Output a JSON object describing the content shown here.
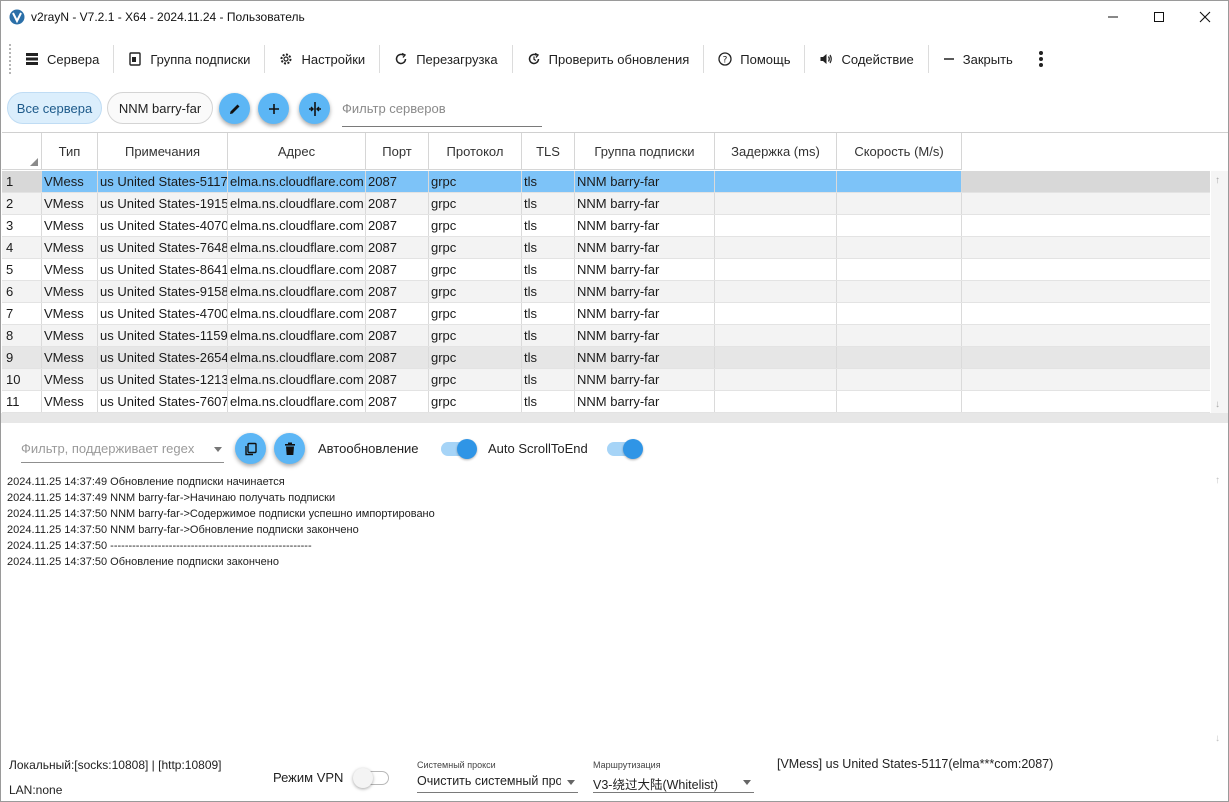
{
  "window": {
    "title": "v2rayN - V7.2.1 - X64 - 2024.11.24 - Пользователь"
  },
  "toolbar": {
    "servers": "Сервера",
    "subscription_group": "Группа подписки",
    "settings": "Настройки",
    "restart": "Перезагрузка",
    "check_updates": "Проверить обновления",
    "help": "Помощь",
    "promotion": "Содействие",
    "close": "Закрыть"
  },
  "filters": {
    "all_servers": "Все сервера",
    "subscription_chip": "NNM barry-far",
    "server_filter_placeholder": "Фильтр серверов"
  },
  "grid": {
    "columns": [
      "Тип",
      "Примечания",
      "Адрес",
      "Порт",
      "Протокол",
      "TLS",
      "Группа подписки",
      "Задержка (ms)",
      "Скорость (M/s)"
    ],
    "rows": [
      {
        "n": "1",
        "type": "VMess",
        "remarks": "us United States-5117",
        "address": "elma.ns.cloudflare.com",
        "port": "2087",
        "protocol": "grpc",
        "tls": "tls",
        "group": "NNM barry-far",
        "delay": "",
        "speed": ""
      },
      {
        "n": "2",
        "type": "VMess",
        "remarks": "us United States-1915",
        "address": "elma.ns.cloudflare.com",
        "port": "2087",
        "protocol": "grpc",
        "tls": "tls",
        "group": "NNM barry-far",
        "delay": "",
        "speed": ""
      },
      {
        "n": "3",
        "type": "VMess",
        "remarks": "us United States-4070",
        "address": "elma.ns.cloudflare.com",
        "port": "2087",
        "protocol": "grpc",
        "tls": "tls",
        "group": "NNM barry-far",
        "delay": "",
        "speed": ""
      },
      {
        "n": "4",
        "type": "VMess",
        "remarks": "us United States-7648",
        "address": "elma.ns.cloudflare.com",
        "port": "2087",
        "protocol": "grpc",
        "tls": "tls",
        "group": "NNM barry-far",
        "delay": "",
        "speed": ""
      },
      {
        "n": "5",
        "type": "VMess",
        "remarks": "us United States-8641",
        "address": "elma.ns.cloudflare.com",
        "port": "2087",
        "protocol": "grpc",
        "tls": "tls",
        "group": "NNM barry-far",
        "delay": "",
        "speed": ""
      },
      {
        "n": "6",
        "type": "VMess",
        "remarks": "us United States-9158",
        "address": "elma.ns.cloudflare.com",
        "port": "2087",
        "protocol": "grpc",
        "tls": "tls",
        "group": "NNM barry-far",
        "delay": "",
        "speed": ""
      },
      {
        "n": "7",
        "type": "VMess",
        "remarks": "us United States-4700",
        "address": "elma.ns.cloudflare.com",
        "port": "2087",
        "protocol": "grpc",
        "tls": "tls",
        "group": "NNM barry-far",
        "delay": "",
        "speed": ""
      },
      {
        "n": "8",
        "type": "VMess",
        "remarks": "us United States-1159",
        "address": "elma.ns.cloudflare.com",
        "port": "2087",
        "protocol": "grpc",
        "tls": "tls",
        "group": "NNM barry-far",
        "delay": "",
        "speed": ""
      },
      {
        "n": "9",
        "type": "VMess",
        "remarks": "us United States-2654",
        "address": "elma.ns.cloudflare.com",
        "port": "2087",
        "protocol": "grpc",
        "tls": "tls",
        "group": "NNM barry-far",
        "delay": "",
        "speed": ""
      },
      {
        "n": "10",
        "type": "VMess",
        "remarks": "us United States-1213",
        "address": "elma.ns.cloudflare.com",
        "port": "2087",
        "protocol": "grpc",
        "tls": "tls",
        "group": "NNM barry-far",
        "delay": "",
        "speed": ""
      },
      {
        "n": "11",
        "type": "VMess",
        "remarks": "us United States-7607",
        "address": "elma.ns.cloudflare.com",
        "port": "2087",
        "protocol": "grpc",
        "tls": "tls",
        "group": "NNM barry-far",
        "delay": "",
        "speed": ""
      }
    ],
    "selected_row": 0
  },
  "log": {
    "filter_placeholder": "Фильтр, поддерживает regex",
    "auto_refresh_label": "Автообновление",
    "auto_scroll_label": "Auto ScrollToEnd",
    "lines": [
      "2024.11.25 14:37:49 Обновление подписки начинается",
      "2024.11.25 14:37:49 NNM barry-far->Начинаю получать подписки",
      "2024.11.25 14:37:50 NNM barry-far->Содержимое подписки успешно импортировано",
      "2024.11.25 14:37:50 NNM barry-far->Обновление подписки закончено",
      "2024.11.25 14:37:50 -------------------------------------------------------",
      "2024.11.25 14:37:50 Обновление подписки закончено"
    ]
  },
  "status": {
    "local": "Локальный:[socks:10808] | [http:10809]",
    "lan": "LAN:none",
    "vpn_mode": "Режим VPN",
    "system_proxy_caption": "Системный прокси",
    "system_proxy_value": "Очистить системный прокси",
    "routing_caption": "Маршрутизация",
    "routing_value": "V3-绕过大陆(Whitelist)",
    "active_server": "[VMess] us United States-5117(elma***com:2087)"
  },
  "colors": {
    "accent": "#2f95e6",
    "selection": "#7dc3f8",
    "round_button": "#5cb6f5"
  }
}
